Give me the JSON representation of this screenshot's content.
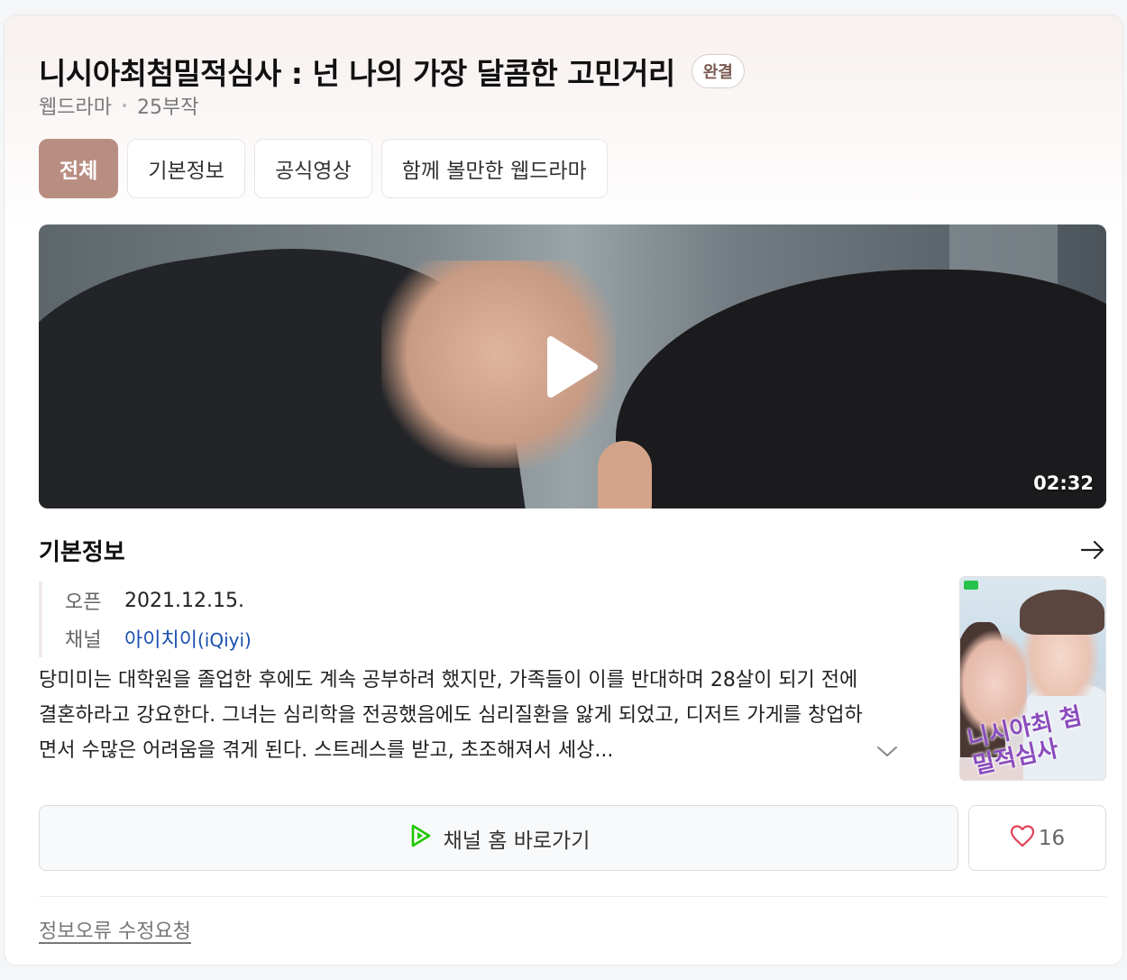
{
  "header": {
    "title": "니시아최첨밀적심사 : 넌 나의 가장 달콤한 고민거리",
    "status_badge": "완결",
    "genre": "웹드라마",
    "episodes": "25부작"
  },
  "tabs": [
    {
      "label": "전체",
      "active": true
    },
    {
      "label": "기본정보",
      "active": false
    },
    {
      "label": "공식영상",
      "active": false
    },
    {
      "label": "함께 볼만한 웹드라마",
      "active": false
    }
  ],
  "video": {
    "duration": "02:32",
    "play_icon": "play-icon"
  },
  "basic_info": {
    "section_title": "기본정보",
    "arrow_icon": "arrow-right-icon",
    "open_label": "오픈",
    "open_value": "2021.12.15.",
    "channel_label": "채널",
    "channel_value": "아이치이",
    "channel_value_en": "(iQiyi)",
    "description": "당미미는 대학원을 졸업한 후에도 계속 공부하려 했지만, 가족들이 이를 반대하며 28살이 되기 전에 결혼하라고 강요한다. 그녀는 심리학을 전공했음에도 심리질환을 앓게 되었고, 디저트 가게를 창업하면서 수많은 어려움을 겪게 된다. 스트레스를 받고, 초조해져서 세상...",
    "expand_icon": "chevron-down-icon",
    "poster_text": "니시아최 첨밀적심사"
  },
  "actions": {
    "channel_home": "채널 홈 바로가기",
    "like_count": "16"
  },
  "footer": {
    "report_link": "정보오류 수정요청"
  },
  "colors": {
    "accent": "#b98e82",
    "link": "#1a4fb0",
    "play_green": "#1ec800",
    "heart_red": "#e0435a"
  }
}
